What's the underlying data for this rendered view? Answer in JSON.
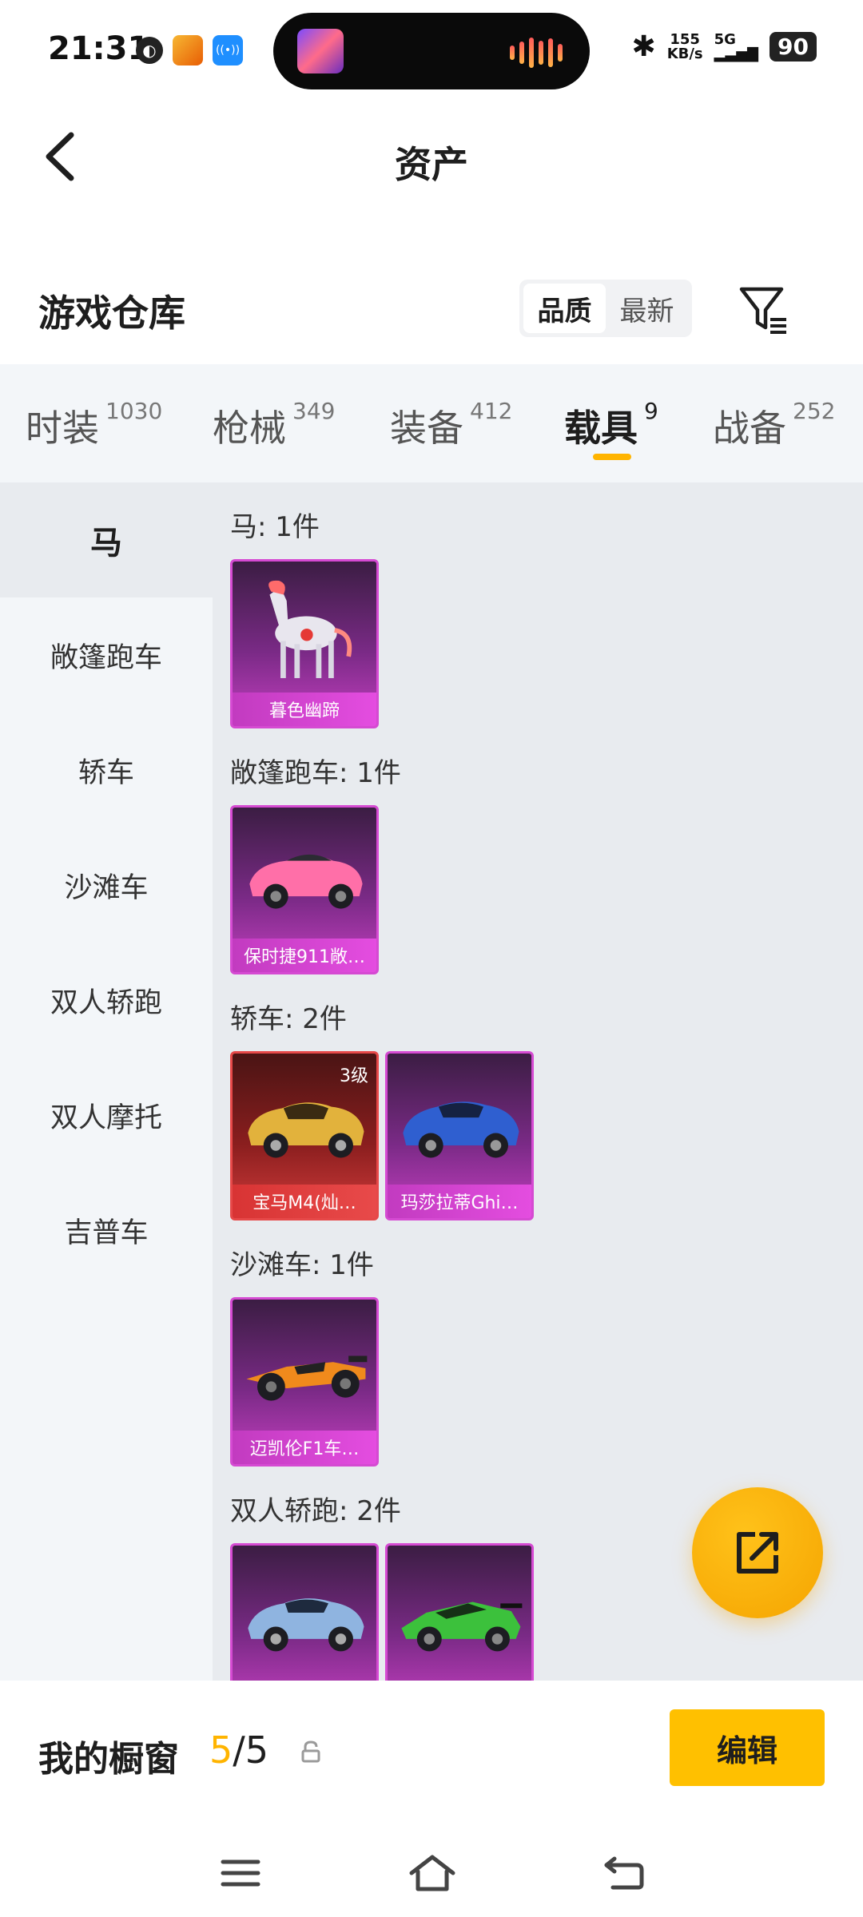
{
  "status_bar": {
    "time": "21:31",
    "net_speed_value": "155",
    "net_speed_unit": "KB/s",
    "network": "5G",
    "battery": "90"
  },
  "header": {
    "title": "资产"
  },
  "warehouse": {
    "title": "游戏仓库",
    "sort_options": [
      "品质",
      "最新"
    ],
    "active_sort": "品质"
  },
  "tabs": [
    {
      "label": "时装",
      "count": "1030"
    },
    {
      "label": "枪械",
      "count": "349"
    },
    {
      "label": "装备",
      "count": "412"
    },
    {
      "label": "载具",
      "count": "9"
    },
    {
      "label": "战备",
      "count": "252"
    }
  ],
  "active_tab": "载具",
  "sidebar": {
    "items": [
      "马",
      "敞篷跑车",
      "轿车",
      "沙滩车",
      "双人轿跑",
      "双人摩托",
      "吉普车"
    ],
    "active": "马"
  },
  "groups": [
    {
      "heading": "马: 1件",
      "items": [
        {
          "name": "暮色幽蹄",
          "rarity": "purple"
        }
      ]
    },
    {
      "heading": "敞篷跑车: 1件",
      "items": [
        {
          "name": "保时捷911敞…",
          "rarity": "purple"
        }
      ]
    },
    {
      "heading": "轿车: 2件",
      "items": [
        {
          "name": "宝马M4(灿…",
          "rarity": "red",
          "level": "3级"
        },
        {
          "name": "玛莎拉蒂Ghi…",
          "rarity": "purple"
        }
      ]
    },
    {
      "heading": "沙滩车: 1件",
      "items": [
        {
          "name": "迈凯伦F1车…",
          "rarity": "purple"
        }
      ]
    },
    {
      "heading": "双人轿跑: 2件",
      "items": [
        {
          "name": "",
          "rarity": "purple"
        },
        {
          "name": "",
          "rarity": "purple"
        }
      ]
    }
  ],
  "vitrine": {
    "title": "我的橱窗",
    "used": "5",
    "total": "/5",
    "edit_label": "编辑"
  },
  "colors": {
    "accent": "#ffb400",
    "purple_rarity": "#d54ad2",
    "red_rarity": "#e64848"
  },
  "icons": {
    "back": "back-arrow-icon",
    "filter": "filter-icon",
    "share": "share-external-icon",
    "lock": "lock-icon",
    "nav_menu": "menu-icon",
    "nav_home": "home-icon",
    "nav_back": "back-icon"
  }
}
